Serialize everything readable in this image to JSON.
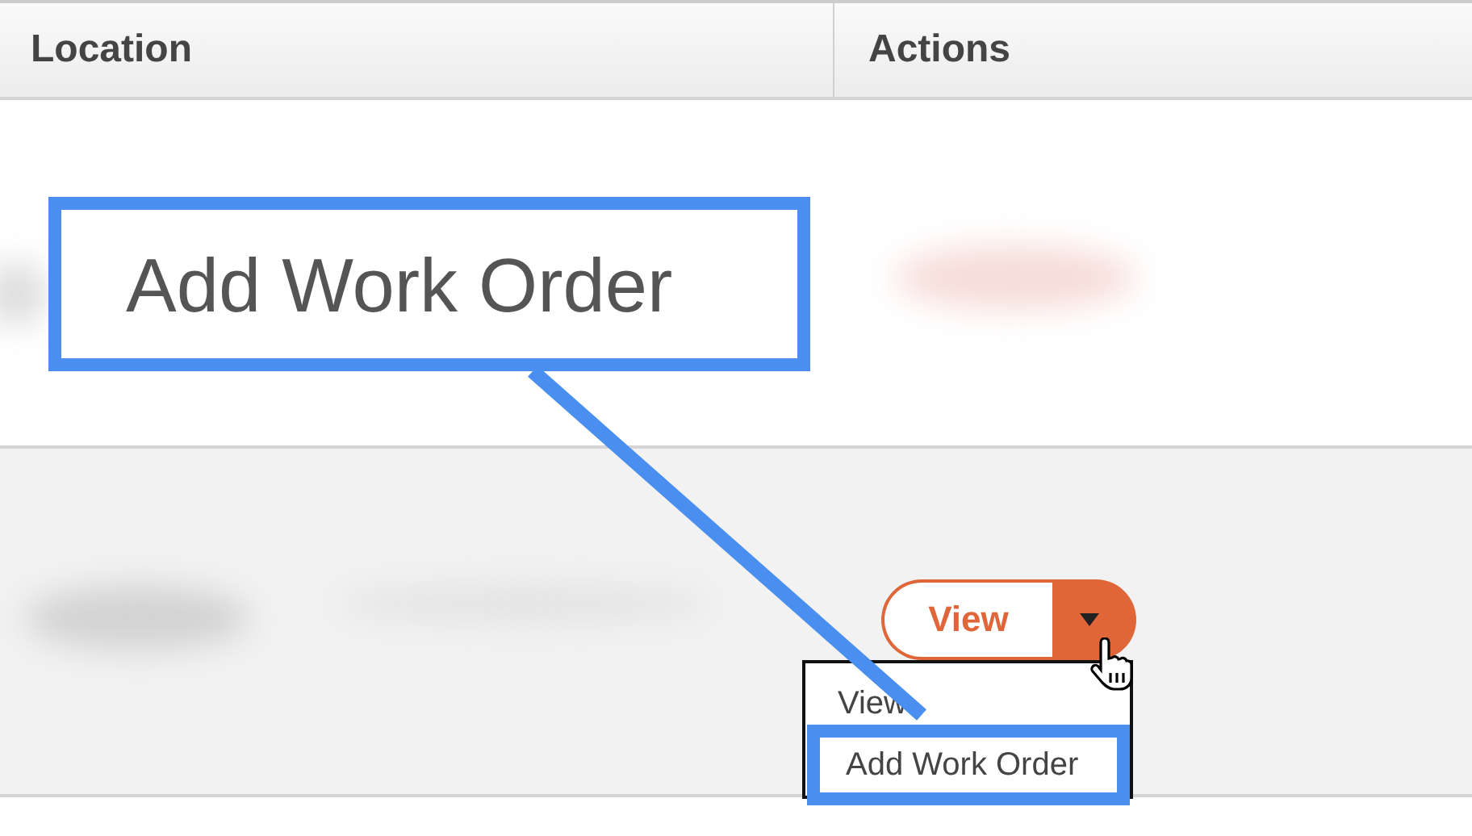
{
  "table": {
    "columns": [
      "Location",
      "Actions"
    ]
  },
  "action_button": {
    "label": "View"
  },
  "dropdown": {
    "items": [
      {
        "label": "View",
        "highlighted": false
      },
      {
        "label": "Add Work Order",
        "highlighted": true
      }
    ]
  },
  "callout": {
    "text": "Add Work Order"
  }
}
